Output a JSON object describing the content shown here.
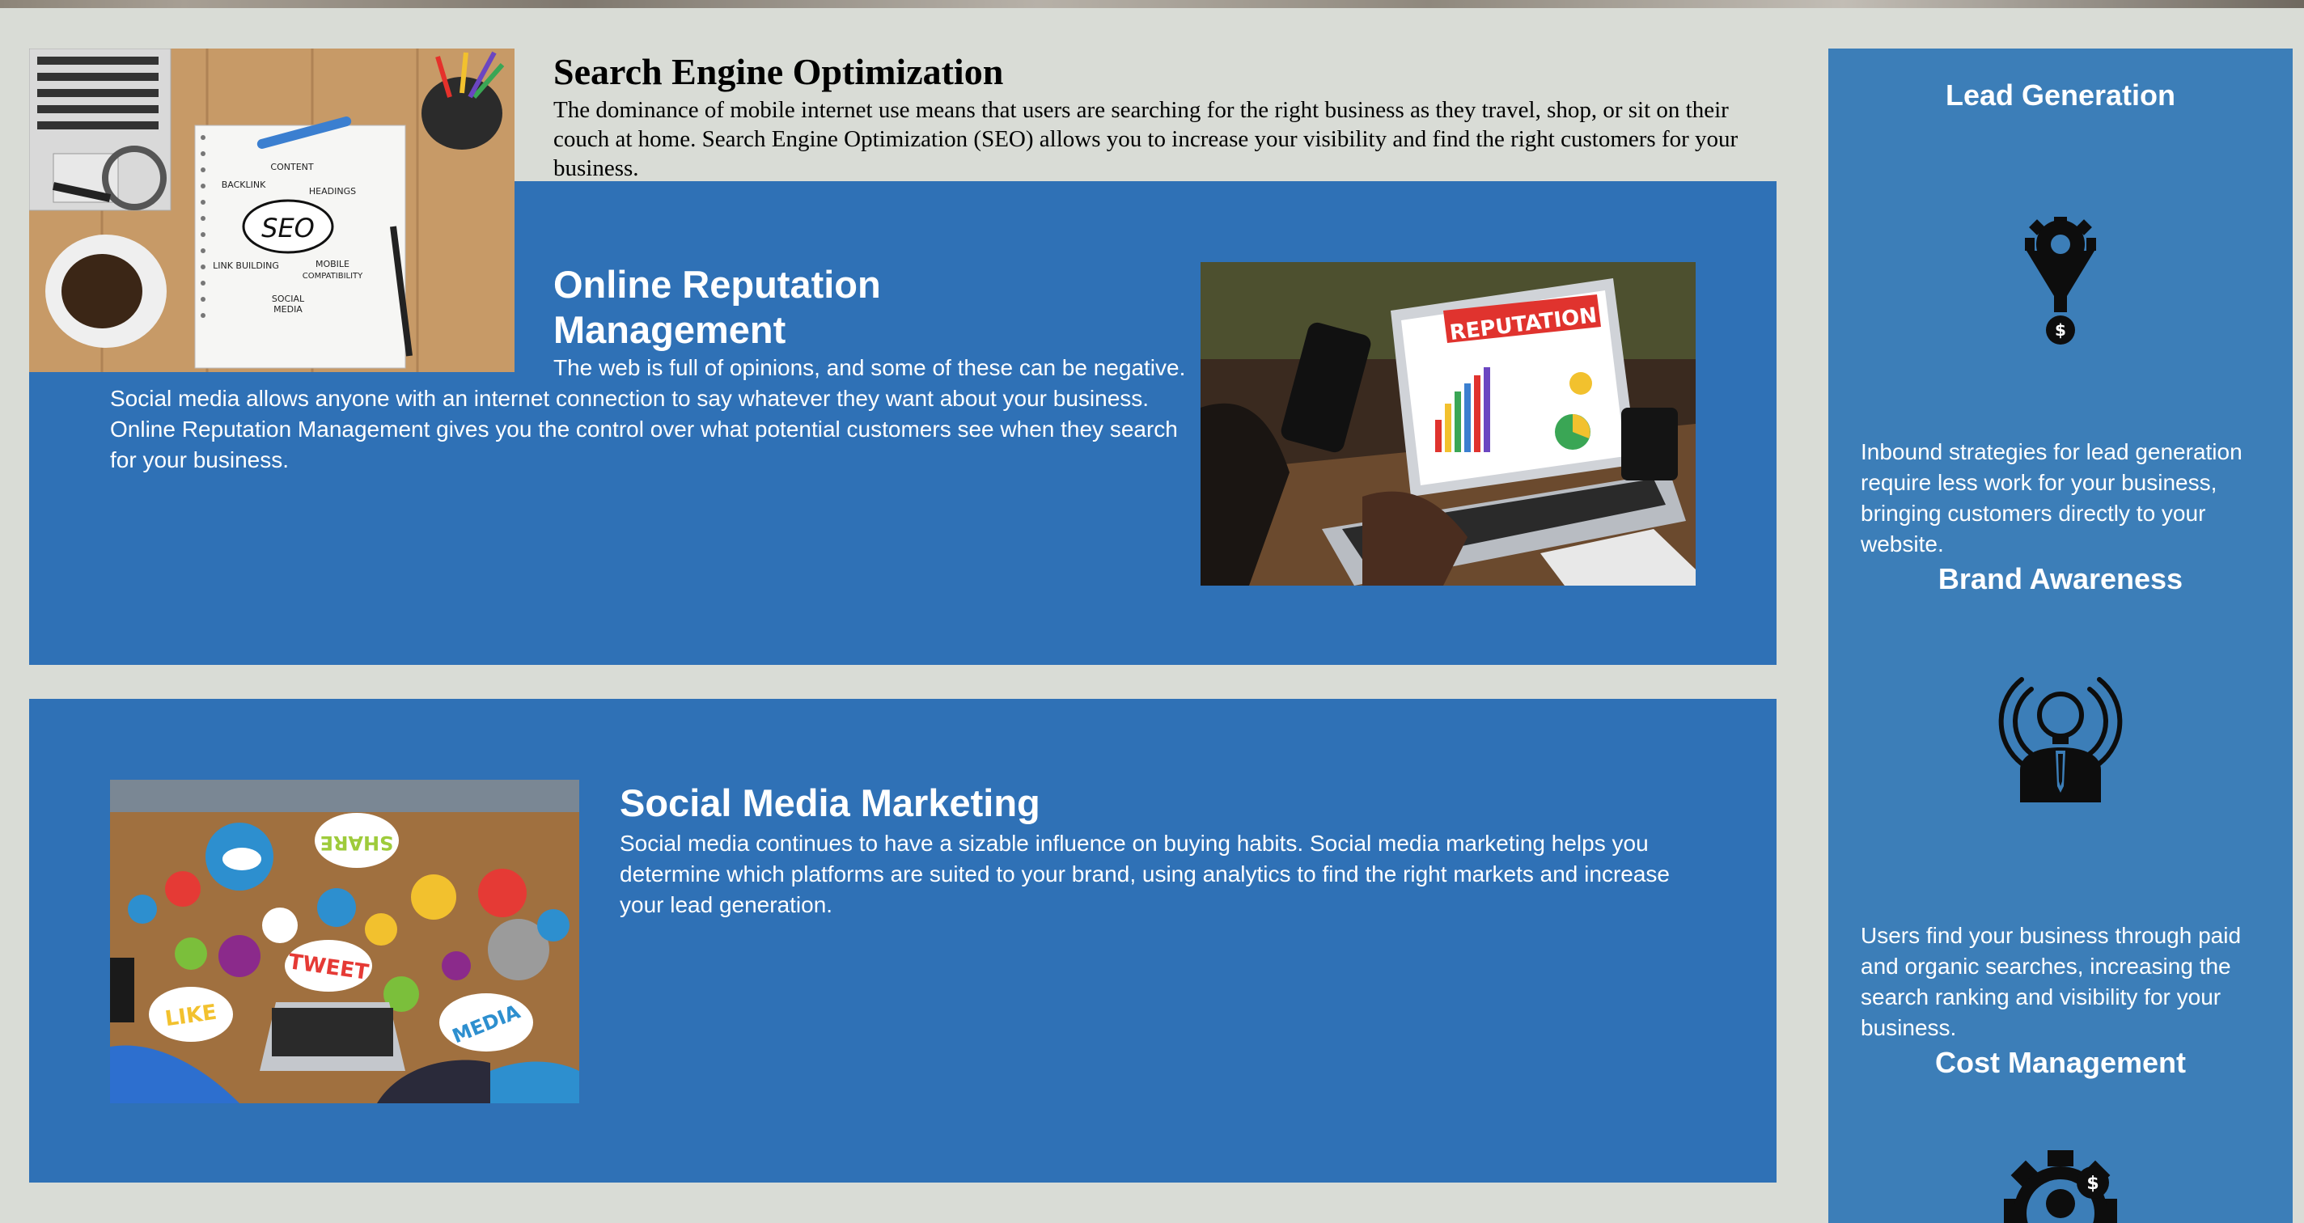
{
  "seo": {
    "title": "Search Engine Optimization",
    "text": "The dominance of mobile internet use means that users are searching for the right business as they travel, shop, or sit on their couch at home. Search Engine Optimization (SEO) allows you to increase your visibility and find the right customers for your business.",
    "image_words": [
      "CONTENT",
      "HEADINGS",
      "BACKLINK",
      "SEO",
      "LINK BUILDING",
      "MOBILE",
      "COMPATIBILITY",
      "SOCIAL",
      "MEDIA"
    ]
  },
  "orm": {
    "title": "Online Reputation Management",
    "text": "The web is full of opinions, and some of these can be negative. Social media allows anyone with an internet connection to say whatever they want about your business. Online Reputation Management gives you the control over what potential customers see when they search for your business.",
    "image_banner": "REPUTATION"
  },
  "smm": {
    "title": "Social Media Marketing",
    "text": "Social media continues to have a sizable influence on buying habits. Social media marketing helps you determine which platforms are suited to your brand, using analytics to find the right markets and increase your lead generation.",
    "image_words": [
      "SHARE",
      "TWEET",
      "LIKE",
      "MEDIA"
    ]
  },
  "benefits": [
    {
      "title": "Lead Generation",
      "icon": "funnel-gear-dollar-icon",
      "text": "Inbound strategies for lead generation require less work for your business, bringing customers directly to your website."
    },
    {
      "title": "Brand Awareness",
      "icon": "lightbulb-person-broadcast-icon",
      "text": "Users find your business through paid and organic searches, increasing the search ranking and visibility for your business."
    },
    {
      "title": "Cost Management",
      "icon": "gear-person-dollar-icon",
      "text": ""
    }
  ],
  "colors": {
    "page_bg": "#d9dcd6",
    "panel_blue": "#2f71b6",
    "sidebar_blue": "#3c7eb8"
  }
}
